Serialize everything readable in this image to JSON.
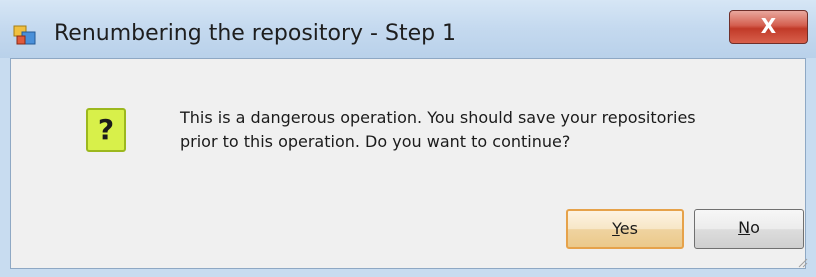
{
  "window": {
    "title": "Renumbering the repository - Step 1",
    "close_label": "X"
  },
  "dialog": {
    "icon_glyph": "?",
    "message_line1": "This is a dangerous operation. You should save your repositories",
    "message_line2": "prior to this operation. Do you want to continue?"
  },
  "buttons": {
    "yes_mnemonic": "Y",
    "yes_rest": "es",
    "no_mnemonic": "N",
    "no_rest": "o"
  },
  "icons": {
    "app_icon": "app-icon",
    "question_icon": "question-icon",
    "close_icon": "close-icon"
  },
  "colors": {
    "close_button": "#c13a28",
    "question_icon_bg": "#d8f04a",
    "default_button_border": "#e6a24a"
  }
}
